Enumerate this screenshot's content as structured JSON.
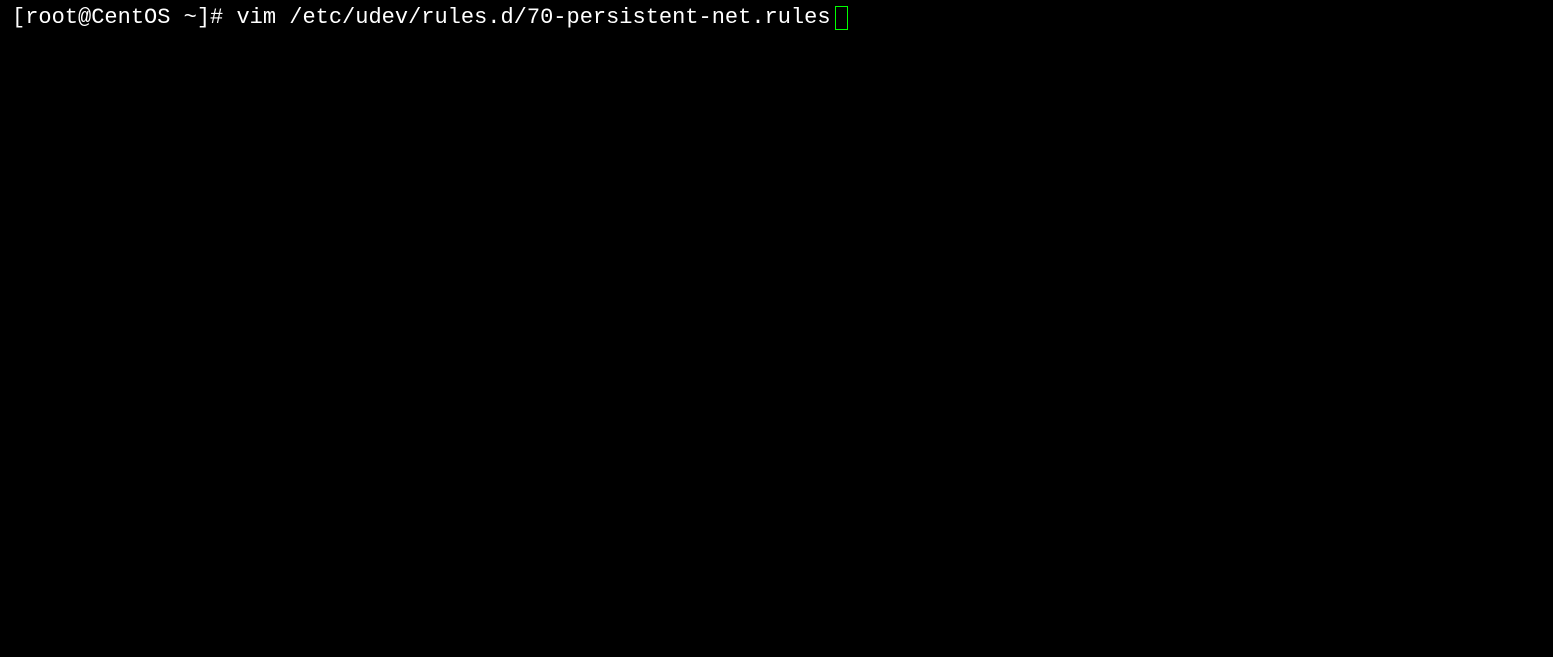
{
  "terminal": {
    "prompt": "[root@CentOS ~]# ",
    "command": "vim /etc/udev/rules.d/70-persistent-net.rules"
  }
}
